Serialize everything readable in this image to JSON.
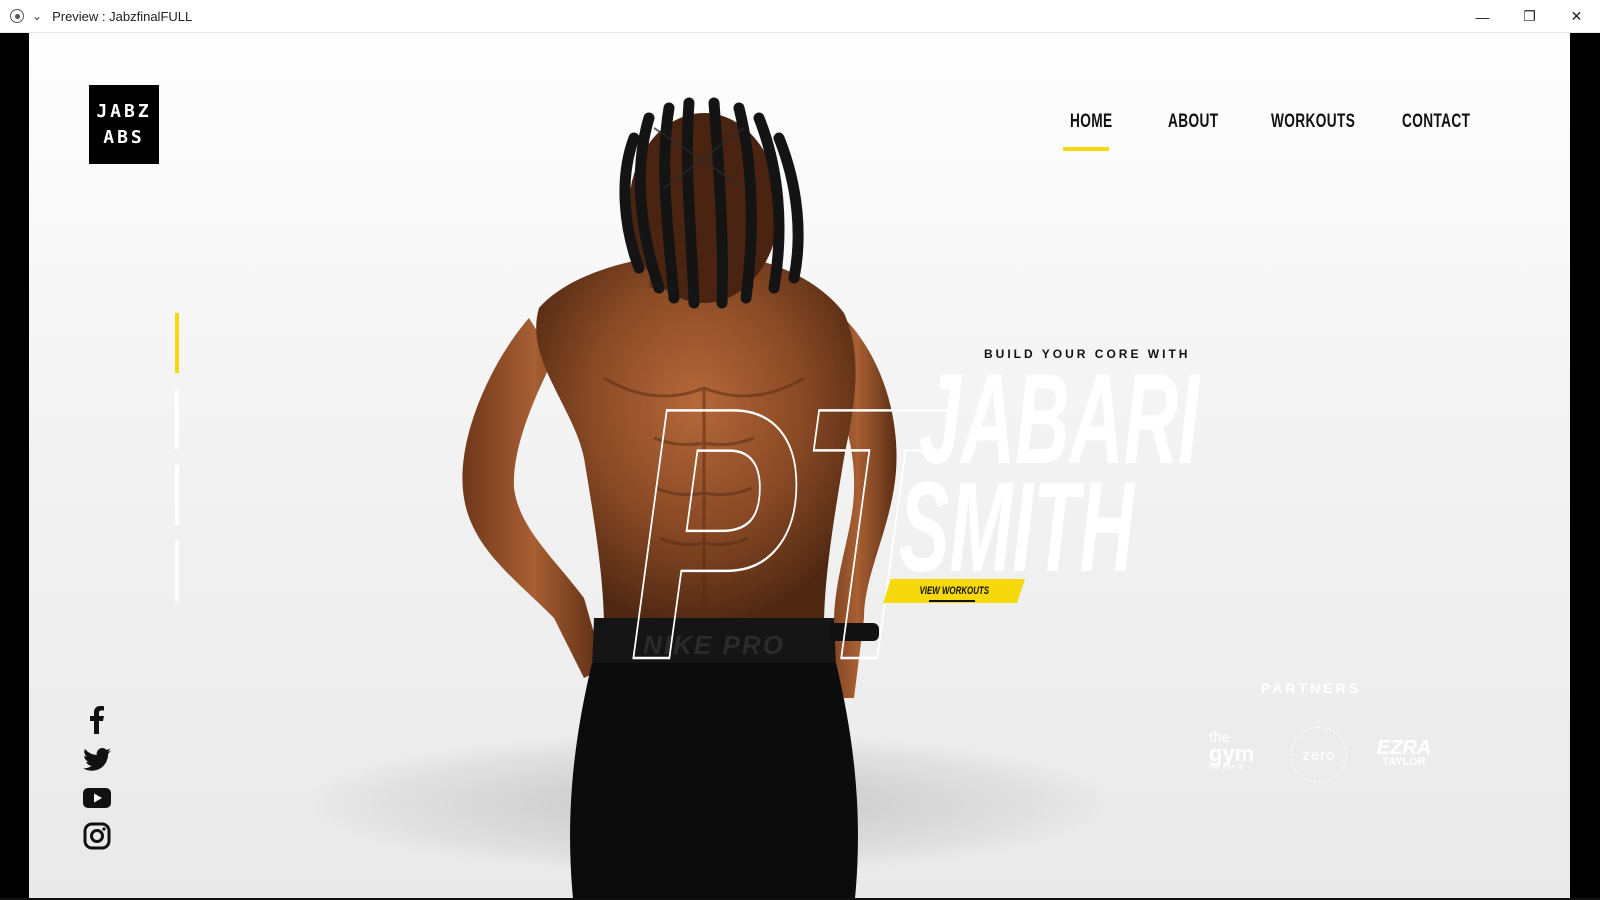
{
  "window": {
    "title": "Preview : JabzfinalFULL",
    "controls": {
      "minimize": "—",
      "restore": "❐",
      "close": "✕"
    }
  },
  "logo": {
    "line1": "JABZ",
    "line2": "ABS"
  },
  "nav": {
    "items": [
      {
        "label": "HOME",
        "active": true
      },
      {
        "label": "ABOUT"
      },
      {
        "label": "WORKOUTS"
      },
      {
        "label": "CONTACT"
      }
    ],
    "accent": "#f5d90a"
  },
  "slider": {
    "current": 1,
    "total": 4
  },
  "social": [
    "facebook-icon",
    "twitter-icon",
    "youtube-icon",
    "instagram-icon"
  ],
  "hero": {
    "tagline": "BUILD YOUR CORE WITH",
    "outline_letters": "PT",
    "first_name": "JABARI",
    "last_name": "SMITH",
    "cta_label": "VIEW WORKOUTS",
    "shorts_text": "NIKE PRO"
  },
  "partners": {
    "title": "PARTNERS",
    "logos": [
      {
        "line1": "the",
        "line2": "gym",
        "line3": "find your fit"
      },
      {
        "line1": "zero"
      },
      {
        "line1": "EZRA",
        "line2": "TAYLOR"
      }
    ]
  },
  "colors": {
    "accent": "#f5d90a",
    "text": "#111111",
    "background": "#f3f3f3"
  }
}
